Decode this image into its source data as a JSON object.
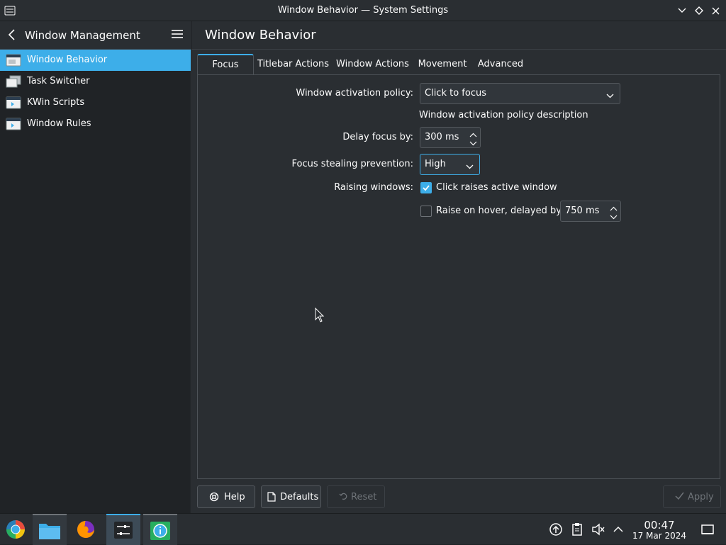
{
  "window": {
    "title": "Window Behavior — System Settings"
  },
  "sidebar": {
    "header_label": "Window Management",
    "items": [
      {
        "label": "Window Behavior",
        "active": true,
        "icon": "window-behavior-icon"
      },
      {
        "label": "Task Switcher",
        "active": false,
        "icon": "task-switcher-icon"
      },
      {
        "label": "KWin Scripts",
        "active": false,
        "icon": "kwin-scripts-icon"
      },
      {
        "label": "Window Rules",
        "active": false,
        "icon": "window-rules-icon"
      }
    ]
  },
  "page": {
    "title": "Window Behavior",
    "tabs": [
      {
        "label": "Focus",
        "active": true
      },
      {
        "label": "Titlebar Actions",
        "active": false
      },
      {
        "label": "Window Actions",
        "active": false
      },
      {
        "label": "Movement",
        "active": false
      },
      {
        "label": "Advanced",
        "active": false
      }
    ]
  },
  "focus": {
    "activation_policy_label": "Window activation policy:",
    "activation_policy_value": "Click to focus",
    "activation_policy_description": "Window activation policy description",
    "delay_focus_label": "Delay focus by:",
    "delay_focus_value": "300 ms",
    "stealing_prevention_label": "Focus stealing prevention:",
    "stealing_prevention_value": "High",
    "raising_label": "Raising windows:",
    "click_raises_label": "Click raises active window",
    "click_raises_checked": true,
    "raise_on_hover_label": "Raise on hover, delayed by:",
    "raise_on_hover_checked": false,
    "raise_on_hover_value": "750 ms"
  },
  "footer": {
    "help_label": "Help",
    "defaults_label": "Defaults",
    "reset_label": "Reset",
    "apply_label": "Apply"
  },
  "taskbar": {
    "time": "00:47",
    "date": "17 Mar 2024"
  },
  "colors": {
    "accent": "#3daee9",
    "background": "#2a2e32",
    "sidebar": "#202326"
  }
}
